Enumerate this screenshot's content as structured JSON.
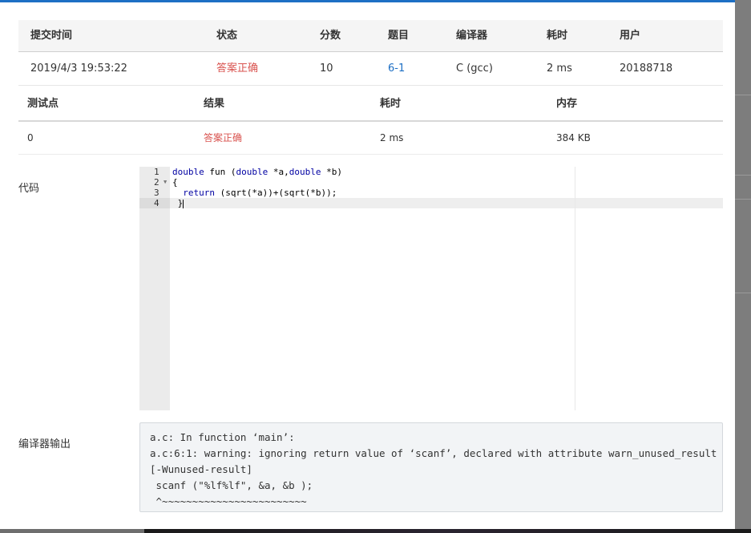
{
  "submission": {
    "headers": [
      "提交时间",
      "状态",
      "分数",
      "题目",
      "编译器",
      "耗时",
      "用户"
    ],
    "row": {
      "time": "2019/4/3 19:53:22",
      "status": "答案正确",
      "score": "10",
      "problem": "6-1",
      "compiler": "C (gcc)",
      "duration": "2 ms",
      "user": "20188718"
    }
  },
  "testpoints": {
    "headers": [
      "测试点",
      "结果",
      "耗时",
      "内存"
    ],
    "rows": [
      {
        "id": "0",
        "result": "答案正确",
        "time": "2 ms",
        "memory": "384 KB"
      }
    ]
  },
  "code_label": "代码",
  "code": {
    "line_numbers": [
      "1",
      "2",
      "3",
      "4"
    ],
    "lines": [
      {
        "kw1": "double",
        "mid1": " fun (",
        "kw2": "double",
        "mid2": " *a,",
        "kw3": "double",
        "end": " *b)"
      },
      {
        "text": "{"
      },
      {
        "indent": "  ",
        "kw": "return",
        "rest": " (sqrt(*a))+(sqrt(*b));"
      },
      {
        "text": " }"
      }
    ]
  },
  "compiler_output_label": "编译器输出",
  "compiler_output": [
    "a.c: In function ‘main’:",
    "a.c:6:1: warning: ignoring return value of ‘scanf’, declared with attribute warn_unused_result",
    "[-Wunused-result]",
    " scanf (\"%lf%lf\", &a, &b );",
    " ^~~~~~~~~~~~~~~~~~~~~~~~~"
  ],
  "colors": {
    "accent": "#1d6fc4",
    "status_accepted": "#d9534f"
  }
}
